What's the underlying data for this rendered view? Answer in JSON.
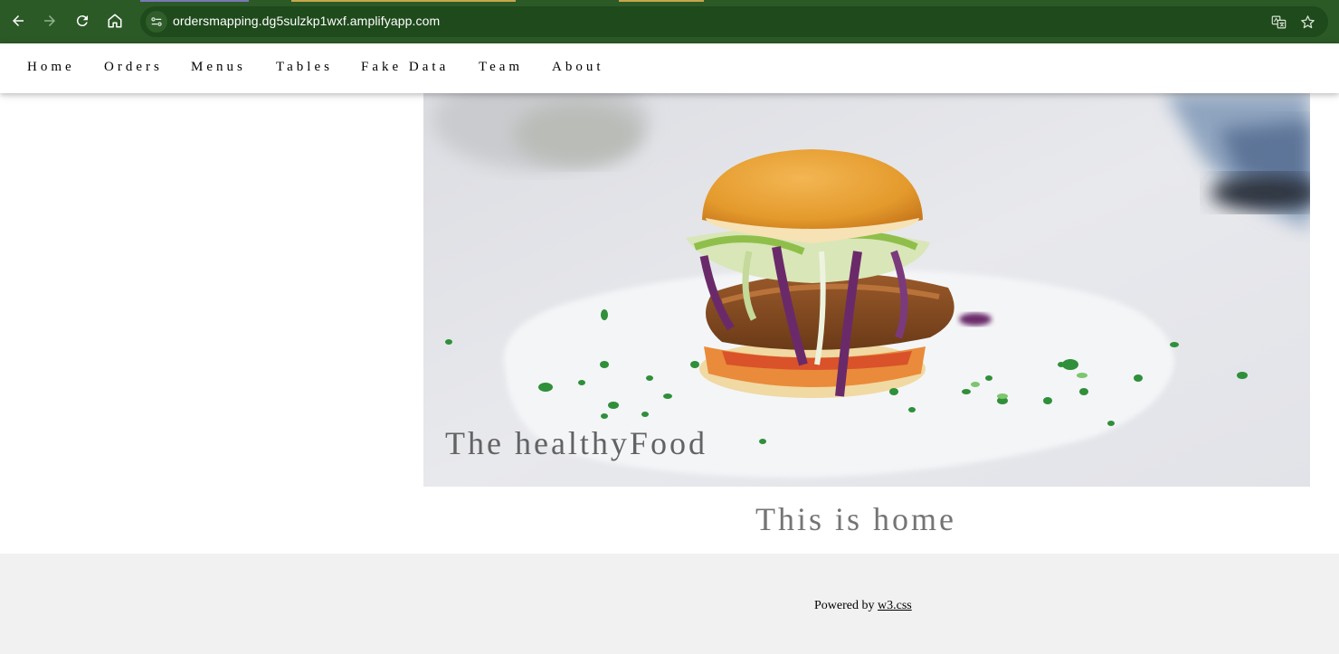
{
  "browser": {
    "url": "ordersmapping.dg5sulzkp1wxf.amplifyapp.com",
    "chrome_color": "#2b5a27"
  },
  "nav": {
    "items": [
      "Home",
      "Orders",
      "Menus",
      "Tables",
      "Fake Data",
      "Team",
      "About"
    ]
  },
  "hero": {
    "caption": "The healthyFood",
    "image": "burger-photo"
  },
  "main": {
    "heading": "This is home"
  },
  "footer": {
    "powered_text": "Powered by",
    "powered_link": "w3.css"
  }
}
